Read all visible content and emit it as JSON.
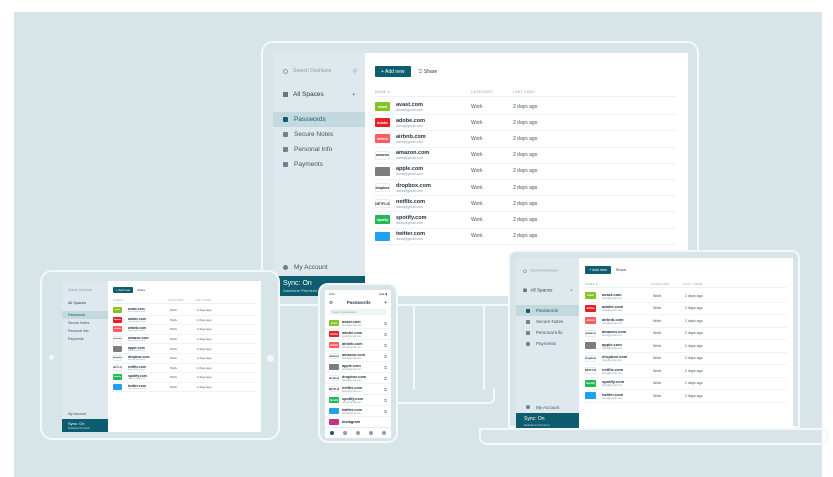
{
  "sidebar": {
    "search_placeholder": "Search Dashlane",
    "spaces_label": "All Spaces",
    "items": [
      {
        "label": "Passwords",
        "active": true
      },
      {
        "label": "Secure Notes",
        "active": false
      },
      {
        "label": "Personal Info",
        "active": false
      },
      {
        "label": "Payments",
        "active": false
      }
    ],
    "account_label": "My Account",
    "sync_label": "Sync: On",
    "sync_sub": "Dashlane Premium"
  },
  "toolbar": {
    "add_label": "+  Add new",
    "share_label": "Share"
  },
  "table": {
    "columns": [
      "NAME ▾",
      "CATEGORY",
      "LAST USED"
    ],
    "rows": [
      {
        "site": "avast.com",
        "email": "dana@gmail.com",
        "category": "Work",
        "last_used": "2 days ago",
        "logo": "avast",
        "color": "#86c225",
        "light": false
      },
      {
        "site": "adobe.com",
        "email": "dana@gmail.com",
        "category": "Work",
        "last_used": "2 days ago",
        "logo": "Adobe",
        "color": "#ed1c24",
        "light": false
      },
      {
        "site": "airbnb.com",
        "email": "dana@gmail.com",
        "category": "Work",
        "last_used": "2 days ago",
        "logo": "airbnb",
        "color": "#ff5a5f",
        "light": false
      },
      {
        "site": "amazon.com",
        "email": "dana@gmail.com",
        "category": "Work",
        "last_used": "2 days ago",
        "logo": "amazon",
        "color": "#ffffff",
        "light": true
      },
      {
        "site": "apple.com",
        "email": "dana@gmail.com",
        "category": "Work",
        "last_used": "2 days ago",
        "logo": "",
        "color": "#7d7d7d",
        "light": false
      },
      {
        "site": "dropbox.com",
        "email": "dana@gmail.com",
        "category": "Work",
        "last_used": "2 days ago",
        "logo": "dropbox",
        "color": "#ffffff",
        "light": true
      },
      {
        "site": "netflix.com",
        "email": "dana@gmail.com",
        "category": "Work",
        "last_used": "2 days ago",
        "logo": "NETFLIX",
        "color": "#ffffff",
        "light": true
      },
      {
        "site": "spotify.com",
        "email": "dana@gmail.com",
        "category": "Work",
        "last_used": "2 days ago",
        "logo": "Spotify",
        "color": "#1db954",
        "light": false
      },
      {
        "site": "twitter.com",
        "email": "dana@gmail.com",
        "category": "Work",
        "last_used": "2 days ago",
        "logo": "",
        "color": "#1da1f2",
        "light": false
      }
    ]
  },
  "phone": {
    "time": "9:41",
    "signal": "●●● ▮",
    "title": "Passwords",
    "search_placeholder": "Search passwords",
    "extra_row_site": "Instagram"
  },
  "colors": {
    "accent": "#0e5c70",
    "background": "#d7e5e9",
    "sidebar": "#dfe9ed"
  }
}
